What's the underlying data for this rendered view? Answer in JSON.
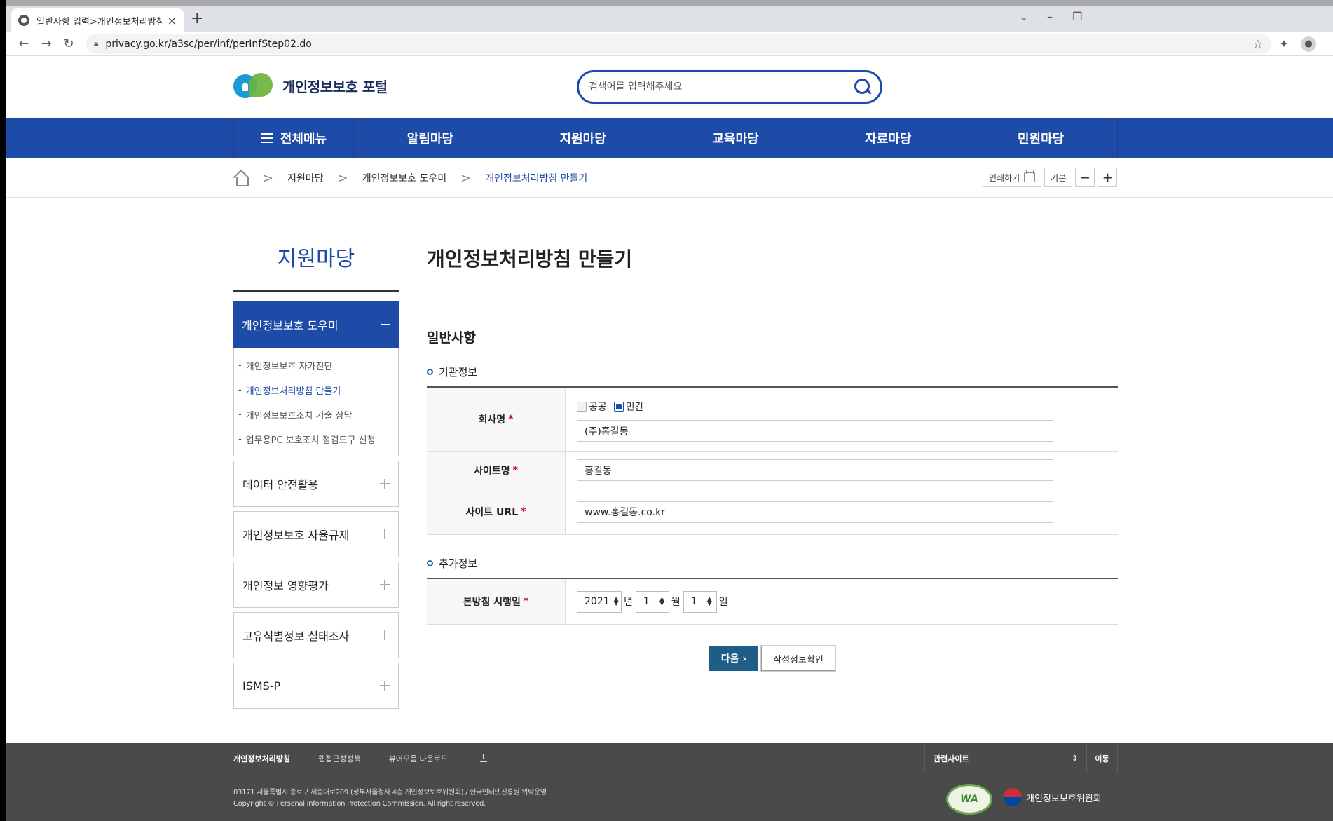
{
  "browser": {
    "tab_title": "일반사항 입력>개인정보처리방침",
    "tab_close": "×",
    "new_tab": "+",
    "url": "privacy.go.kr/a3sc/per/inf/perInfStep02.do",
    "back": "←",
    "forward": "→",
    "reload": "↻",
    "minimize": "–",
    "restore": "❐"
  },
  "header": {
    "logo_text": "개인정보보호 포털",
    "search_placeholder": "검색어를 입력해주세요"
  },
  "gnb": {
    "all_menu": "전체메뉴",
    "items": [
      "알림마당",
      "지원마당",
      "교육마당",
      "자료마당",
      "민원마당"
    ]
  },
  "breadcrumb": {
    "items": [
      "지원마당",
      "개인정보보호 도우미",
      "개인정보처리방침 만들기"
    ],
    "separator": ">"
  },
  "tools": {
    "print": "인쇄하기",
    "default": "기본",
    "zoom_out": "−",
    "zoom_in": "+"
  },
  "lnb": {
    "title": "지원마당",
    "active": "개인정보보호 도우미",
    "sub_items": [
      "개인정보보호 자가진단",
      "개인정보처리방침 만들기",
      "개인정보보호조치 기술 상담",
      "업무용PC 보호조치 점검도구 신청"
    ],
    "sub_prefix": "-",
    "items": [
      "데이터 안전활용",
      "개인정보보호 자율규제",
      "개인정보 영향평가",
      "고유식별정보 실태조사",
      "ISMS-P"
    ]
  },
  "content": {
    "page_title": "개인정보처리방침 만들기",
    "section_title": "일반사항",
    "sub1": "기관정보",
    "sub2": "추가정보",
    "required_mark": "*",
    "company_label": "회사명",
    "org_type_options": [
      "공공",
      "민간"
    ],
    "org_type_selected": "민간",
    "company_value": "(주)홍길동",
    "site_name_label": "사이트명",
    "site_name_value": "홍길동",
    "site_url_label": "사이트 URL",
    "site_url_value": "www.홍길동.co.kr",
    "effective_date_label": "본방침 시행일",
    "year": "2021",
    "year_unit": "년",
    "month": "1",
    "month_unit": "월",
    "day": "1",
    "day_unit": "일",
    "next_button": "다음 ›",
    "check_button": "작성정보확인"
  },
  "footer": {
    "links": [
      "개인정보처리방침",
      "웹접근성정책",
      "뷰어모음 다운로드"
    ],
    "related_sites": "관련사이트",
    "go": "이동",
    "address": "03171 서울특별시 종로구 세종대로209 (정부서울청사 4층 개인정보보호위원회) / 한국인터넷진흥원 위탁운영",
    "copyright": "Copyright © Personal Information Protection Commission. All right reserved.",
    "wa_mark": "WA",
    "org_name": "개인정보보호위원회"
  }
}
